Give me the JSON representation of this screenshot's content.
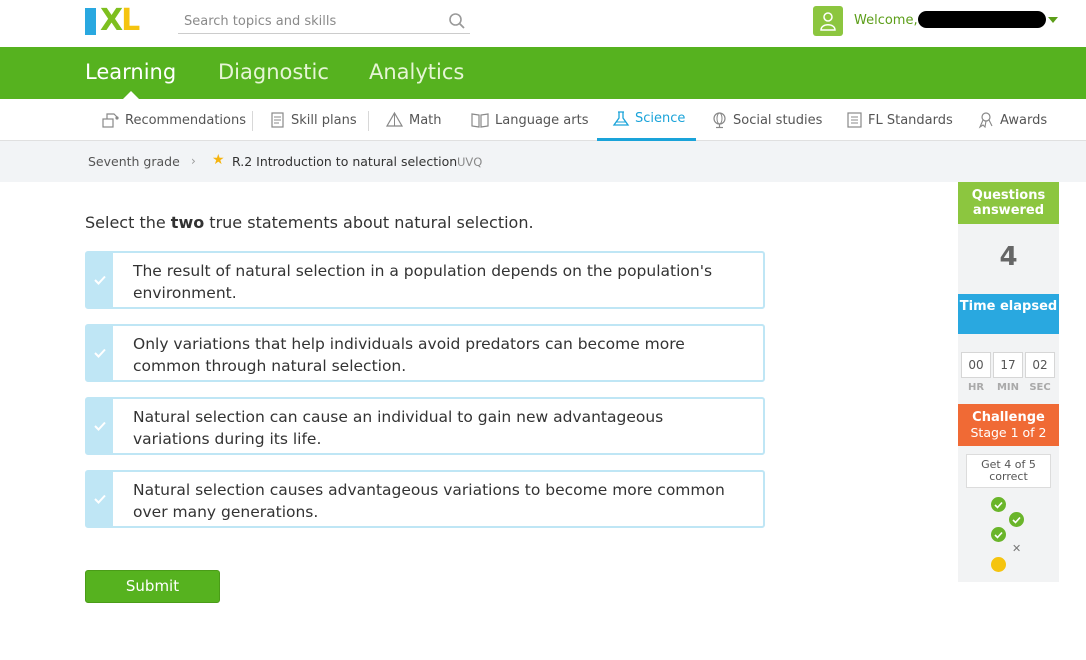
{
  "header": {
    "search_placeholder": "Search topics and skills",
    "welcome_text": "Welcome,"
  },
  "main_nav": {
    "tabs": [
      {
        "label": "Learning",
        "active": true
      },
      {
        "label": "Diagnostic",
        "active": false
      },
      {
        "label": "Analytics",
        "active": false
      }
    ]
  },
  "subject_nav": {
    "items": [
      {
        "label": "Recommendations",
        "icon": "recommendations-icon"
      },
      {
        "label": "Skill plans",
        "icon": "skill-plans-icon"
      },
      {
        "label": "Math",
        "icon": "math-pyramid-icon"
      },
      {
        "label": "Language arts",
        "icon": "book-icon"
      },
      {
        "label": "Science",
        "icon": "flask-icon",
        "active": true
      },
      {
        "label": "Social studies",
        "icon": "globe-icon"
      },
      {
        "label": "FL Standards",
        "icon": "standards-icon"
      },
      {
        "label": "Awards",
        "icon": "awards-icon"
      }
    ]
  },
  "breadcrumb": {
    "grade": "Seventh grade",
    "skill": "R.2 Introduction to natural selection",
    "code": "UVQ"
  },
  "question": {
    "prompt_before": "Select the ",
    "prompt_bold": "two",
    "prompt_after": " true statements about natural selection.",
    "choices": [
      "The result of natural selection in a population depends on the population's environment.",
      "Only variations that help individuals avoid predators can become more common through natural selection.",
      "Natural selection can cause an individual to gain new advantageous variations during its life.",
      "Natural selection causes advantageous variations to become more common over many generations."
    ],
    "submit_label": "Submit"
  },
  "sidebar": {
    "questions_answered_label": "Questions answered",
    "questions_answered_count": "4",
    "time_elapsed_label": "Time elapsed",
    "time": {
      "hr": "00",
      "min": "17",
      "sec": "02"
    },
    "time_units": {
      "hr": "HR",
      "min": "MIN",
      "sec": "SEC"
    },
    "challenge_label": "Challenge",
    "challenge_stage": "Stage 1 of 2",
    "goal_text": "Get 4 of 5 correct",
    "progress": [
      "correct",
      "correct",
      "correct",
      "incorrect",
      "current"
    ]
  },
  "colors": {
    "brand_green": "#56b21f",
    "science_blue": "#1aa3d9",
    "challenge_orange": "#f06a35",
    "choice_border": "#bfe6f5"
  }
}
